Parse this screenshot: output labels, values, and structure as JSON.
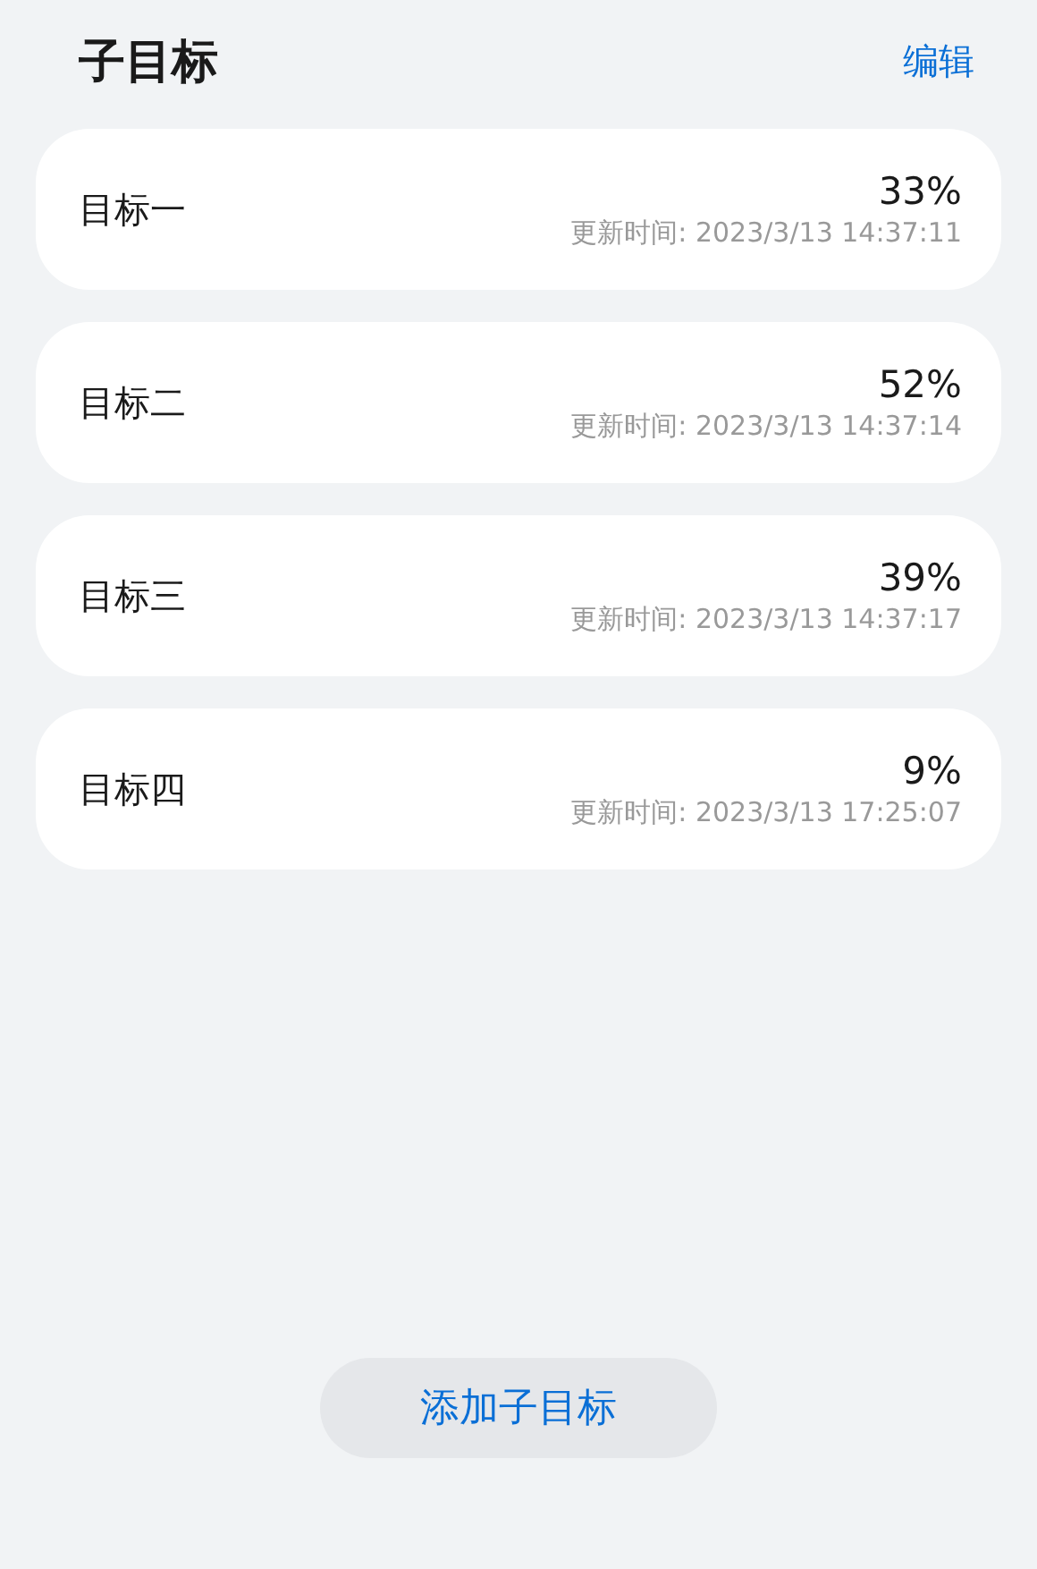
{
  "header": {
    "title": "子目标",
    "action": "编辑"
  },
  "goals": [
    {
      "name": "目标一",
      "percent": "33%",
      "updated": "更新时间: 2023/3/13 14:37:11"
    },
    {
      "name": "目标二",
      "percent": "52%",
      "updated": "更新时间: 2023/3/13 14:37:14"
    },
    {
      "name": "目标三",
      "percent": "39%",
      "updated": "更新时间: 2023/3/13 14:37:17"
    },
    {
      "name": "目标四",
      "percent": "9%",
      "updated": "更新时间: 2023/3/13 17:25:07"
    }
  ],
  "add_button": "添加子目标"
}
